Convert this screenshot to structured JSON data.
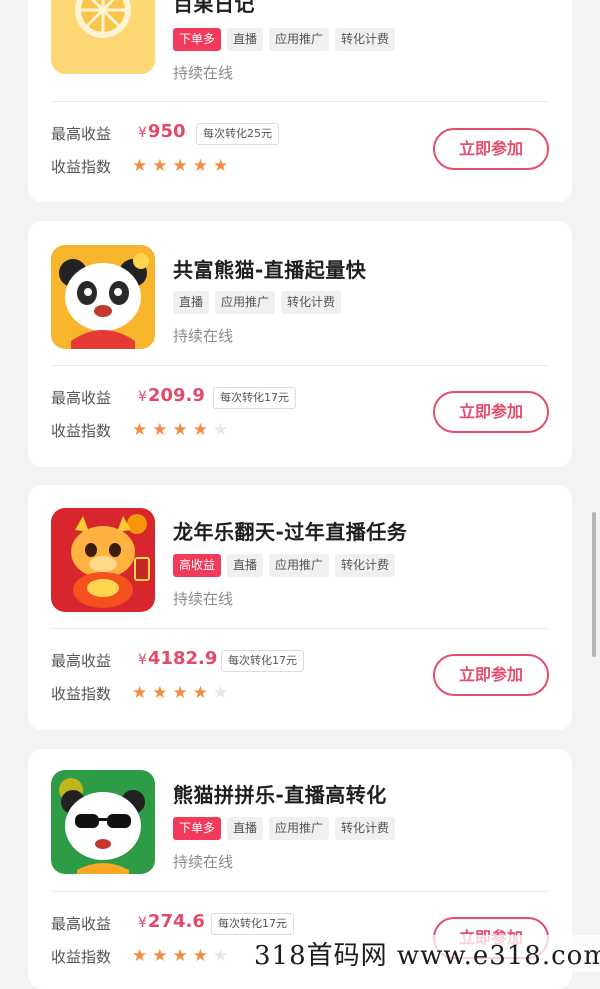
{
  "common": {
    "max_earning_label": "最高收益",
    "earning_index_label": "收益指数",
    "join_label": "立即参加",
    "status": "持续在线",
    "currency": "¥"
  },
  "cards": [
    {
      "title": "百果日记",
      "tags": [
        "下单多",
        "直播",
        "应用推广",
        "转化计费"
      ],
      "hot_tag": true,
      "price": "950",
      "per_conversion": "每次转化25元",
      "rating": 5,
      "icon": "citrus-icon"
    },
    {
      "title": "共富熊猫-直播起量快",
      "tags": [
        "直播",
        "应用推广",
        "转化计费"
      ],
      "hot_tag": false,
      "price": "209.9",
      "per_conversion": "每次转化17元",
      "rating": 4,
      "icon": "panda-icon"
    },
    {
      "title": "龙年乐翻天-过年直播任务",
      "tags": [
        "高收益",
        "直播",
        "应用推广",
        "转化计费"
      ],
      "hot_tag": true,
      "price": "4182.9",
      "per_conversion": "每次转化17元",
      "rating": 4,
      "icon": "dragon-icon"
    },
    {
      "title": "熊猫拼拼乐-直播高转化",
      "tags": [
        "下单多",
        "直播",
        "应用推广",
        "转化计费"
      ],
      "hot_tag": true,
      "price": "274.6",
      "per_conversion": "每次转化17元",
      "rating": 4,
      "icon": "panda-sunglasses-icon"
    }
  ],
  "watermark": "318首码网 www.e318.com",
  "colors": {
    "accent": "#e44d6d",
    "star": "#f38c44",
    "hot_tag": "#f23a5b"
  }
}
